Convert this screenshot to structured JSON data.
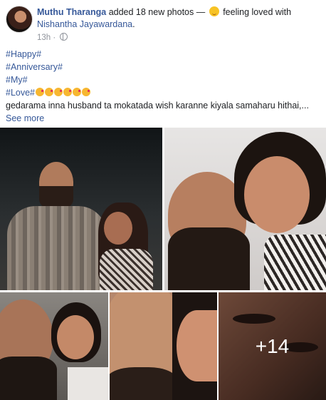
{
  "post": {
    "author": "Muthu Tharanga",
    "action": "added 18 new photos —",
    "feeling": "feeling loved with",
    "tagged": "Nishantha Jayawardana",
    "tagged_suffix": ".",
    "time": "13h",
    "privacy_icon": "globe-icon",
    "lines": {
      "l1": "#Happy#",
      "l2": "#Anniversary#",
      "l3": "#My#",
      "l4": "#Love#",
      "l5": "gedarama inna husband ta mokatada wish karanne kiyala samaharu hithai,..."
    },
    "see_more": "See more",
    "more_photos": "+14"
  }
}
